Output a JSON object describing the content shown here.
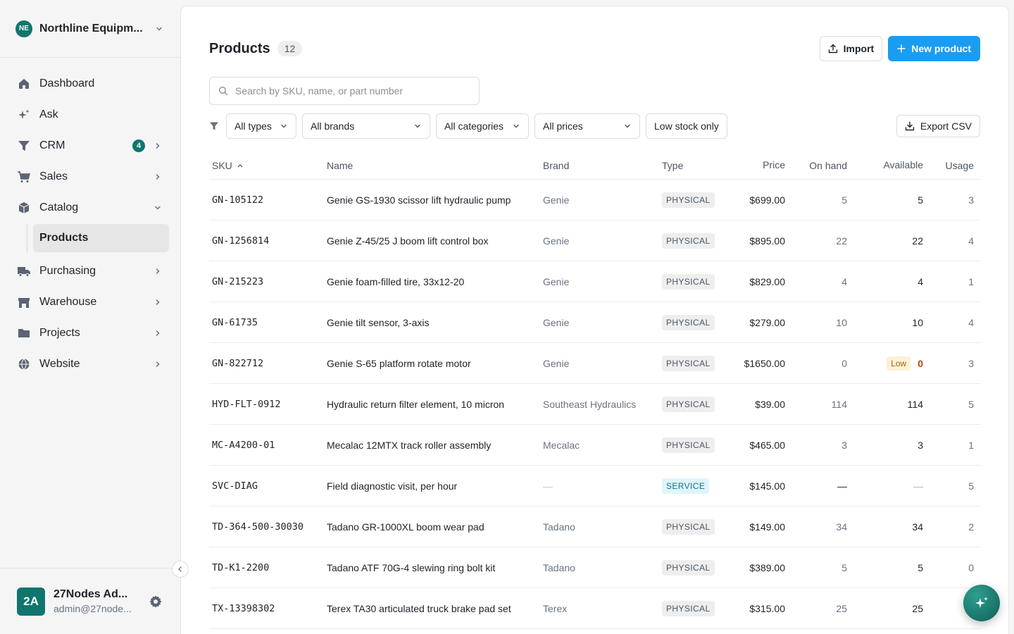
{
  "org": {
    "initials": "NE",
    "name": "Northline Equipm..."
  },
  "nav": {
    "dashboard": "Dashboard",
    "ask": "Ask",
    "crm": "CRM",
    "crm_badge": "4",
    "sales": "Sales",
    "catalog": "Catalog",
    "products": "Products",
    "purchasing": "Purchasing",
    "warehouse": "Warehouse",
    "projects": "Projects",
    "website": "Website"
  },
  "user": {
    "initials": "2A",
    "name": "27Nodes Ad...",
    "email": "admin@27node..."
  },
  "header": {
    "title": "Products",
    "count": "12",
    "import_label": "Import",
    "new_label": "New product"
  },
  "search": {
    "placeholder": "Search by SKU, name, or part number"
  },
  "filters": {
    "types": "All types",
    "brands": "All brands",
    "categories": "All categories",
    "prices": "All prices",
    "low_stock": "Low stock only",
    "export": "Export CSV"
  },
  "table": {
    "columns": {
      "sku": "SKU",
      "name": "Name",
      "brand": "Brand",
      "type": "Type",
      "price": "Price",
      "on_hand": "On hand",
      "available": "Available",
      "usage": "Usage"
    },
    "rows": [
      {
        "sku": "GN-105122",
        "name": "Genie GS-1930 scissor lift hydraulic pump",
        "brand": "Genie",
        "type": "PHYSICAL",
        "price": "$699.00",
        "on_hand": "5",
        "available": "5",
        "usage": "3"
      },
      {
        "sku": "GN-1256814",
        "name": "Genie Z-45/25 J boom lift control box",
        "brand": "Genie",
        "type": "PHYSICAL",
        "price": "$895.00",
        "on_hand": "22",
        "available": "22",
        "usage": "4"
      },
      {
        "sku": "GN-215223",
        "name": "Genie foam-filled tire, 33x12-20",
        "brand": "Genie",
        "type": "PHYSICAL",
        "price": "$829.00",
        "on_hand": "4",
        "available": "4",
        "usage": "1"
      },
      {
        "sku": "GN-61735",
        "name": "Genie tilt sensor, 3-axis",
        "brand": "Genie",
        "type": "PHYSICAL",
        "price": "$279.00",
        "on_hand": "10",
        "available": "10",
        "usage": "4"
      },
      {
        "sku": "GN-822712",
        "name": "Genie S-65 platform rotate motor",
        "brand": "Genie",
        "type": "PHYSICAL",
        "price": "$1650.00",
        "on_hand": "0",
        "available": "0",
        "low_label": "Low",
        "usage": "3"
      },
      {
        "sku": "HYD-FLT-0912",
        "name": "Hydraulic return filter element, 10 micron",
        "brand": "Southeast Hydraulics",
        "type": "PHYSICAL",
        "price": "$39.00",
        "on_hand": "114",
        "available": "114",
        "usage": "5"
      },
      {
        "sku": "MC-A4200-01",
        "name": "Mecalac 12MTX track roller assembly",
        "brand": "Mecalac",
        "type": "PHYSICAL",
        "price": "$465.00",
        "on_hand": "3",
        "available": "3",
        "usage": "1"
      },
      {
        "sku": "SVC-DIAG",
        "name": "Field diagnostic visit, per hour",
        "brand": "—",
        "type": "SERVICE",
        "price": "$145.00",
        "on_hand": "—",
        "available": "—",
        "usage": "5"
      },
      {
        "sku": "TD-364-500-30030",
        "name": "Tadano GR-1000XL boom wear pad",
        "brand": "Tadano",
        "type": "PHYSICAL",
        "price": "$149.00",
        "on_hand": "34",
        "available": "34",
        "usage": "2"
      },
      {
        "sku": "TD-K1-2200",
        "name": "Tadano ATF 70G-4 slewing ring bolt kit",
        "brand": "Tadano",
        "type": "PHYSICAL",
        "price": "$389.00",
        "on_hand": "5",
        "available": "5",
        "usage": "0"
      },
      {
        "sku": "TX-13398302",
        "name": "Terex TA30 articulated truck brake pad set",
        "brand": "Terex",
        "type": "PHYSICAL",
        "price": "$315.00",
        "on_hand": "25",
        "available": "25",
        "usage": ""
      }
    ]
  },
  "colors": {
    "primary": "#1a9cf0",
    "brand_teal": "#0f766e",
    "low_warning": "#c2410c"
  }
}
